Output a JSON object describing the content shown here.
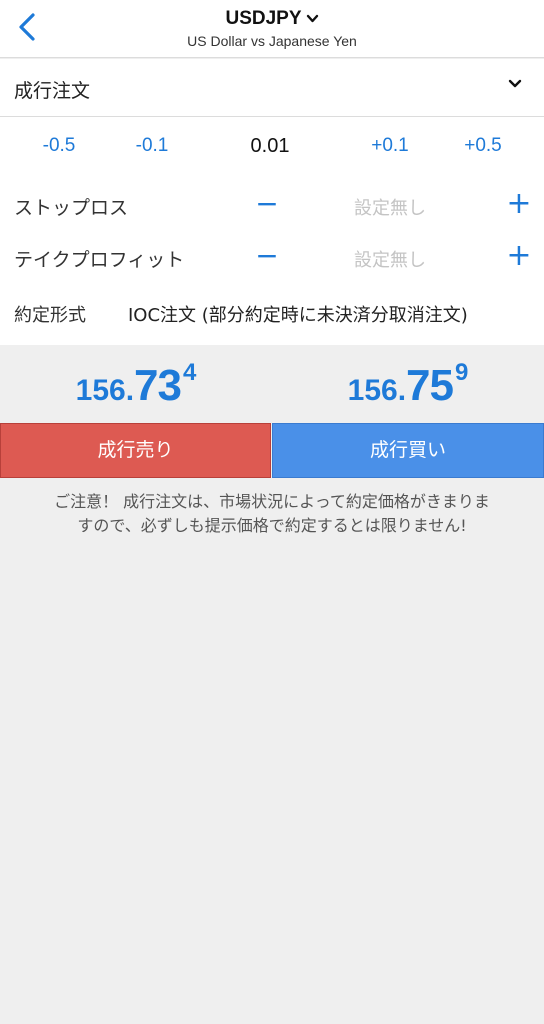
{
  "header": {
    "back_icon": "chevron-left-icon",
    "title": "USDJPY",
    "title_icon": "chevron-down-icon",
    "subtitle": "US Dollar vs Japanese Yen"
  },
  "order_type": {
    "label": "成行注文",
    "icon": "chevron-down-icon"
  },
  "lot": {
    "steps": [
      "-0.5",
      "-0.1",
      "+0.1",
      "+0.5"
    ],
    "value": "0.01"
  },
  "stop_loss": {
    "label": "ストップロス",
    "minus": "−",
    "value": "設定無し",
    "plus": "+"
  },
  "take_profit": {
    "label": "テイクプロフィット",
    "minus": "−",
    "value": "設定無し",
    "plus": "+"
  },
  "execution": {
    "label": "約定形式",
    "value": "IOC注文 (部分約定時に未決済分取消注文)"
  },
  "prices": {
    "bid": {
      "int": "156.",
      "big": "73",
      "sup": "4"
    },
    "ask": {
      "int": "156.",
      "big": "75",
      "sup": "9"
    }
  },
  "buttons": {
    "sell": "成行売り",
    "buy": "成行買い"
  },
  "notice": {
    "line1": "ご注意！ 成行注文は、市場状況によって約定価格がきまりま",
    "line2": "すので、必ずしも提示価格で約定するとは限りません!"
  },
  "colors": {
    "accent": "#1e7ad8",
    "sell": "#dd5a52",
    "buy": "#4a90e8",
    "background": "#efefef"
  }
}
